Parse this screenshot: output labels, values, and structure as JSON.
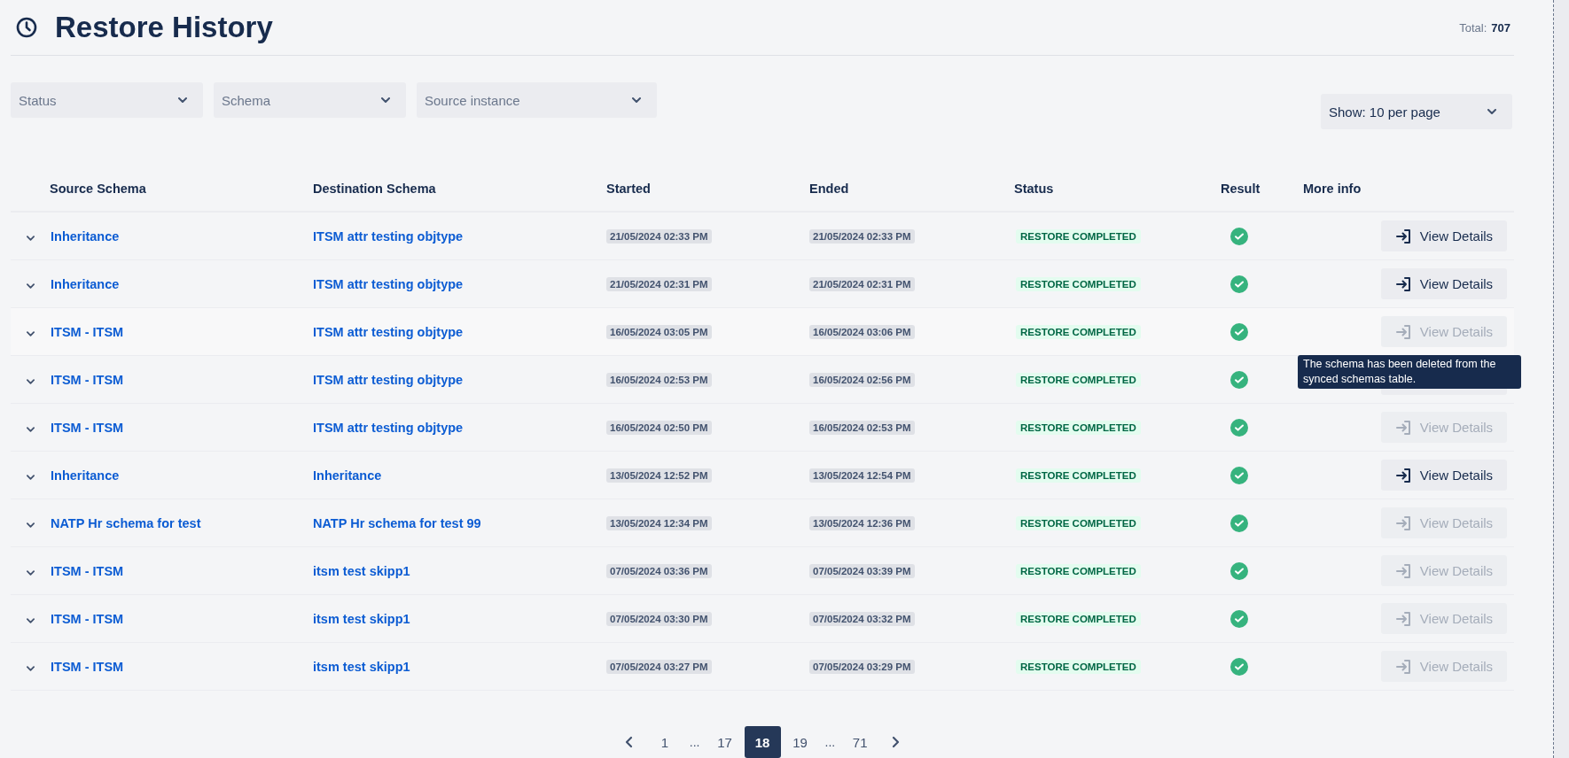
{
  "page": {
    "title": "Restore History",
    "total_label": "Total:",
    "total_value": "707"
  },
  "filters": [
    {
      "placeholder": "Status"
    },
    {
      "placeholder": "Schema"
    },
    {
      "placeholder": "Source instance"
    }
  ],
  "page_size": {
    "value": "Show: 10 per page"
  },
  "table": {
    "columns": [
      "Source Schema",
      "Destination Schema",
      "Started",
      "Ended",
      "Status",
      "Result",
      "More info"
    ],
    "rows": [
      {
        "source": "Inheritance",
        "destination": "ITSM attr testing objtype",
        "started": "21/05/2024 02:33 PM",
        "ended": "21/05/2024 02:33 PM",
        "status": "RESTORE COMPLETED",
        "succeeded": true,
        "details": {
          "label": "View Details",
          "disabled": false
        }
      },
      {
        "source": "Inheritance",
        "destination": "ITSM attr testing objtype",
        "started": "21/05/2024 02:31 PM",
        "ended": "21/05/2024 02:31 PM",
        "status": "RESTORE COMPLETED",
        "succeeded": true,
        "details": {
          "label": "View Details",
          "disabled": false
        }
      },
      {
        "source": "ITSM - ITSM",
        "destination": "ITSM attr testing objtype",
        "started": "16/05/2024 03:05 PM",
        "ended": "16/05/2024 03:06 PM",
        "status": "RESTORE COMPLETED",
        "succeeded": true,
        "hovered": true,
        "details": {
          "label": "View Details",
          "disabled": true,
          "tooltip": "The schema has been deleted from the synced schemas table."
        }
      },
      {
        "source": "ITSM - ITSM",
        "destination": "ITSM attr testing objtype",
        "started": "16/05/2024 02:53 PM",
        "ended": "16/05/2024 02:56 PM",
        "status": "RESTORE COMPLETED",
        "succeeded": true,
        "details": {}
      },
      {
        "source": "ITSM - ITSM",
        "destination": "ITSM attr testing objtype",
        "started": "16/05/2024 02:50 PM",
        "ended": "16/05/2024 02:53 PM",
        "status": "RESTORE COMPLETED",
        "succeeded": true,
        "details": {
          "label": "View Details",
          "disabled": true
        }
      },
      {
        "source": "Inheritance",
        "destination": "Inheritance",
        "started": "13/05/2024 12:52 PM",
        "ended": "13/05/2024 12:54 PM",
        "status": "RESTORE COMPLETED",
        "succeeded": true,
        "details": {
          "label": "View Details",
          "disabled": false
        }
      },
      {
        "source": "NATP Hr schema for test",
        "destination": "NATP Hr schema for test 99",
        "started": "13/05/2024 12:34 PM",
        "ended": "13/05/2024 12:36 PM",
        "status": "RESTORE COMPLETED",
        "succeeded": true,
        "details": {
          "label": "View Details",
          "disabled": true
        }
      },
      {
        "source": "ITSM - ITSM",
        "destination": "itsm test skipp1",
        "started": "07/05/2024 03:36 PM",
        "ended": "07/05/2024 03:39 PM",
        "status": "RESTORE COMPLETED",
        "succeeded": true,
        "details": {
          "label": "View Details",
          "disabled": true
        }
      },
      {
        "source": "ITSM - ITSM",
        "destination": "itsm test skipp1",
        "started": "07/05/2024 03:30 PM",
        "ended": "07/05/2024 03:32 PM",
        "status": "RESTORE COMPLETED",
        "succeeded": true,
        "details": {
          "label": "View Details",
          "disabled": true
        }
      },
      {
        "source": "ITSM - ITSM",
        "destination": "itsm test skipp1",
        "started": "07/05/2024 03:27 PM",
        "ended": "07/05/2024 03:29 PM",
        "status": "RESTORE COMPLETED",
        "succeeded": true,
        "details": {
          "label": "View Details",
          "disabled": true
        }
      }
    ]
  },
  "pagination": [
    {
      "kind": "prev"
    },
    {
      "kind": "page",
      "label": "1",
      "selected": false
    },
    {
      "kind": "gap",
      "label": "..."
    },
    {
      "kind": "page",
      "label": "17",
      "selected": false
    },
    {
      "kind": "page",
      "label": "18",
      "selected": true
    },
    {
      "kind": "page",
      "label": "19",
      "selected": false
    },
    {
      "kind": "gap",
      "label": "..."
    },
    {
      "kind": "page",
      "label": "71",
      "selected": false
    },
    {
      "kind": "next"
    }
  ]
}
